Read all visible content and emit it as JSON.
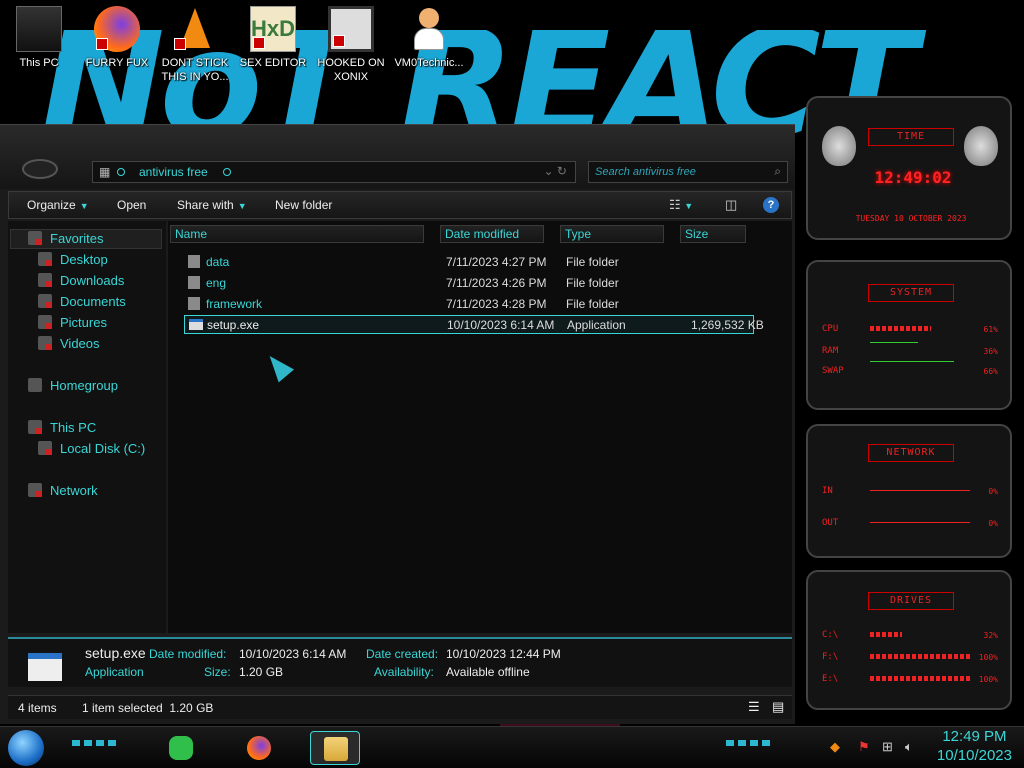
{
  "desktop": {
    "icons": [
      {
        "label": "This PC",
        "icon": "computer-icon"
      },
      {
        "label": "FURRY FUX",
        "icon": "firefox-icon"
      },
      {
        "label": "DONT STICK THIS IN YO...",
        "icon": "vlc-icon"
      },
      {
        "label": "SEX EDITOR",
        "icon": "hxd-icon"
      },
      {
        "label": "HOOKED ON XONIX",
        "icon": "game-icon"
      },
      {
        "label": "VM0Technic...",
        "icon": "user-icon"
      }
    ]
  },
  "explorer": {
    "address": "antivirus free",
    "search_placeholder": "Search antivirus free",
    "toolbar": {
      "organize": "Organize",
      "open": "Open",
      "share_with": "Share with",
      "new_folder": "New folder"
    },
    "nav": {
      "favorites": "Favorites",
      "desktop": "Desktop",
      "downloads": "Downloads",
      "documents": "Documents",
      "pictures": "Pictures",
      "videos": "Videos",
      "homegroup": "Homegroup",
      "this_pc": "This PC",
      "local_disk": "Local Disk (C:)",
      "network": "Network"
    },
    "columns": {
      "name": "Name",
      "date": "Date modified",
      "type": "Type",
      "size": "Size"
    },
    "files": [
      {
        "name": "data",
        "date": "7/11/2023 4:27 PM",
        "type": "File folder",
        "size": ""
      },
      {
        "name": "eng",
        "date": "7/11/2023 4:26 PM",
        "type": "File folder",
        "size": ""
      },
      {
        "name": "framework",
        "date": "7/11/2023 4:28 PM",
        "type": "File folder",
        "size": ""
      },
      {
        "name": "setup.exe",
        "date": "10/10/2023 6:14 AM",
        "type": "Application",
        "size": "1,269,532 KB"
      }
    ],
    "details": {
      "filename": "setup.exe",
      "type": "Application",
      "date_modified_label": "Date modified:",
      "date_modified": "10/10/2023 6:14 AM",
      "size_label": "Size:",
      "size": "1.20 GB",
      "date_created_label": "Date created:",
      "date_created": "10/10/2023 12:44 PM",
      "availability_label": "Availability:",
      "availability": "Available offline"
    },
    "status": {
      "items": "4 items",
      "selected": "1 item selected  1.20 GB"
    }
  },
  "gadgets": {
    "time": {
      "title": "TIME",
      "clock": "12:49:02",
      "date": "TUESDAY 10 OCTOBER 2023"
    },
    "system": {
      "title": "SYSTEM",
      "cpu_label": "CPU",
      "cpu": "61%",
      "ram_label": "RAM",
      "ram": "36%",
      "swap_label": "SWAP",
      "swap": "66%"
    },
    "network": {
      "title": "NETWORK",
      "in_label": "IN",
      "in": "0%",
      "out_label": "OUT",
      "out": "0%"
    },
    "drives": {
      "title": "DRIVES",
      "d1_label": "C:\\",
      "d1": "32%",
      "d2_label": "F:\\",
      "d2": "100%",
      "d3_label": "E:\\",
      "d3": "100%"
    }
  },
  "taskbar": {
    "time": "12:49 PM",
    "date": "10/10/2023"
  },
  "colors": {
    "accent": "#3bd6d6",
    "gadget_red": "#e22",
    "wallpaper_blue": "#1aa7d6"
  }
}
